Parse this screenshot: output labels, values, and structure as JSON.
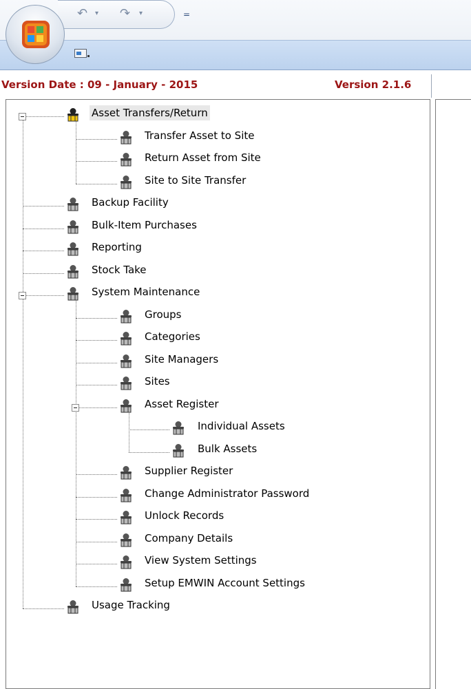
{
  "quick_access": {
    "undo_icon": "undo-icon",
    "redo_icon": "redo-icon",
    "customize_icon": "customize-toolbar-icon",
    "customize_glyph": "="
  },
  "version_bar": {
    "date_text": "Version Date : 09 - January - 2015",
    "version_text": "Version 2.1.6"
  },
  "colors": {
    "version_text": "#9c1515",
    "ribbon": "#c8dbf3"
  },
  "tree": [
    {
      "label": "Asset Transfers/Return",
      "level": 0,
      "selected": true,
      "expanded": true
    },
    {
      "label": "Transfer Asset to Site",
      "level": 1
    },
    {
      "label": "Return Asset from Site",
      "level": 1
    },
    {
      "label": "Site to Site Transfer",
      "level": 1
    },
    {
      "label": "Backup Facility",
      "level": 0
    },
    {
      "label": "Bulk-Item Purchases",
      "level": 0
    },
    {
      "label": "Reporting",
      "level": 0
    },
    {
      "label": "Stock Take",
      "level": 0
    },
    {
      "label": "System Maintenance",
      "level": 0,
      "expanded": true
    },
    {
      "label": "Groups",
      "level": 1
    },
    {
      "label": "Categories",
      "level": 1
    },
    {
      "label": "Site Managers",
      "level": 1
    },
    {
      "label": "Sites",
      "level": 1
    },
    {
      "label": "Asset Register",
      "level": 1,
      "expanded": true
    },
    {
      "label": "Individual Assets",
      "level": 2
    },
    {
      "label": "Bulk Assets",
      "level": 2
    },
    {
      "label": "Supplier Register",
      "level": 1
    },
    {
      "label": "Change Administrator Password",
      "level": 1
    },
    {
      "label": "Unlock Records",
      "level": 1
    },
    {
      "label": "Company Details",
      "level": 1
    },
    {
      "label": "View System Settings",
      "level": 1
    },
    {
      "label": "Setup EMWIN Account Settings",
      "level": 1
    },
    {
      "label": "Usage Tracking",
      "level": 0
    }
  ]
}
